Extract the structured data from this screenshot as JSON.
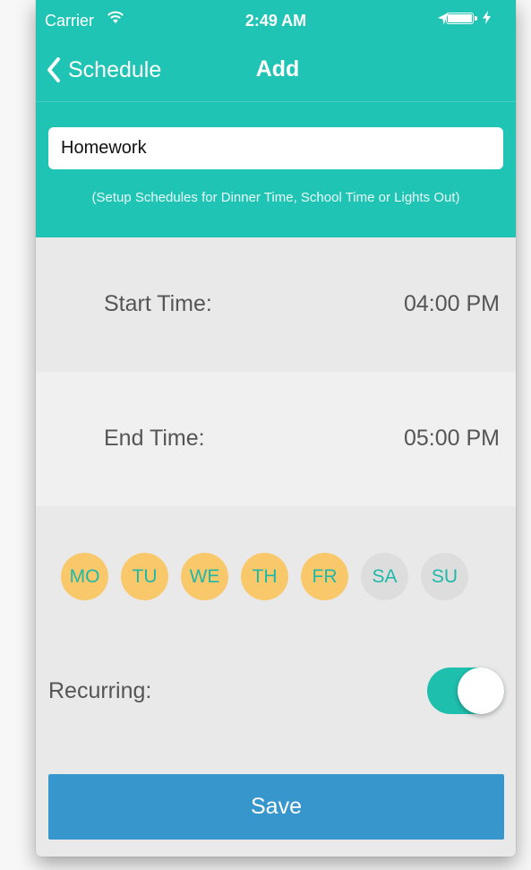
{
  "status_bar": {
    "carrier": "Carrier",
    "time": "2:49 AM"
  },
  "nav": {
    "back_label": "Schedule",
    "title": "Add"
  },
  "form": {
    "name_value": "Homework",
    "hint": "(Setup Schedules for Dinner Time, School Time or Lights Out)",
    "start_label": "Start Time:",
    "start_value": "04:00 PM",
    "end_label": "End Time:",
    "end_value": "05:00 PM",
    "days": [
      {
        "label": "MO",
        "selected": true
      },
      {
        "label": "TU",
        "selected": true
      },
      {
        "label": "WE",
        "selected": true
      },
      {
        "label": "TH",
        "selected": true
      },
      {
        "label": "FR",
        "selected": true
      },
      {
        "label": "SA",
        "selected": false
      },
      {
        "label": "SU",
        "selected": false
      }
    ],
    "recurring_label": "Recurring:",
    "recurring_on": true,
    "save_label": "Save"
  },
  "colors": {
    "header": "#20c4b4",
    "day_selected": "#f9c86a",
    "day_unselected": "#dddddd",
    "save": "#3796cc",
    "toggle_on": "#1fbfae"
  },
  "icons": [
    "wifi-icon",
    "location-arrow-icon",
    "battery-icon",
    "charging-bolt-icon",
    "chevron-left-icon"
  ]
}
